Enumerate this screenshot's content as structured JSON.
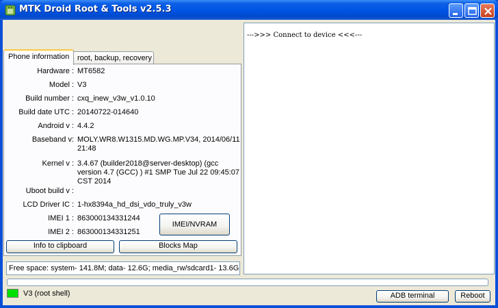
{
  "window": {
    "title": "MTK Droid Root & Tools v2.5.3"
  },
  "tabs": [
    {
      "label": "Phone information",
      "active": true
    },
    {
      "label": "root, backup, recovery",
      "active": false
    }
  ],
  "phone_info": {
    "hardware": {
      "label": "Hardware :",
      "value": "MT6582"
    },
    "model": {
      "label": "Model :",
      "value": "V3"
    },
    "build_number": {
      "label": "Build number :",
      "value": "cxq_inew_v3w_v1.0.10"
    },
    "build_date": {
      "label": "Build date UTC :",
      "value": "20140722-014640"
    },
    "android": {
      "label": "Android  v :",
      "value": "4.4.2"
    },
    "baseband": {
      "label": "Baseband v:",
      "value": "MOLY.WR8.W1315.MD.WG.MP.V34, 2014/06/11 21:48"
    },
    "kernel": {
      "label": "Kernel v :",
      "value": "3.4.67 (builder2018@server-desktop) (gcc version 4.7 (GCC) ) #1 SMP  Tue Jul 22 09:45:07 CST 2014"
    },
    "uboot": {
      "label": "Uboot build v :",
      "value": ""
    },
    "lcd_driver": {
      "label": "LCD Driver IC :",
      "value": "1-hx8394a_hd_dsi_vdo_truly_v3w"
    },
    "imei1": {
      "label": "IMEI 1 :",
      "value": "863000134331244"
    },
    "imei2": {
      "label": "IMEI 2 :",
      "value": "863000134331251"
    }
  },
  "buttons": {
    "imei_nvram": "IMEI/NVRAM",
    "info_to_clipboard": "Info to clipboard",
    "blocks_map": "Blocks Map",
    "adb_terminal": "ADB terminal",
    "reboot": "Reboot"
  },
  "free_space": "Free space: system- 141.8M; data- 12.6G; media_rw/sdcard1- 13.6G;",
  "log": {
    "text": "--->>> Connect to device <<<---"
  },
  "status": {
    "text": "V3 (root shell)",
    "indicator_color": "#00e000"
  },
  "colors": {
    "titlebar": "#0054e3",
    "client_bg": "#ece9d8"
  }
}
